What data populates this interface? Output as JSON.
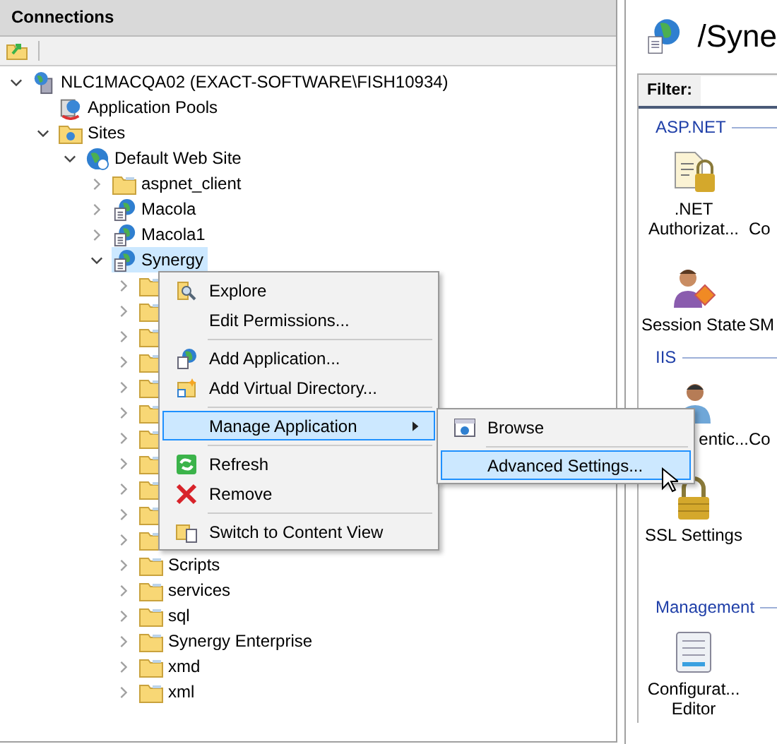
{
  "connections": {
    "title": "Connections"
  },
  "tree": [
    {
      "label": "NLC1MACQA02 (EXACT-SOFTWARE\\FISH10934)",
      "kind": "server",
      "expanded": true,
      "selected": false,
      "children": [
        {
          "label": "Application Pools",
          "kind": "pools",
          "selected": false
        },
        {
          "label": "Sites",
          "kind": "sites",
          "expanded": true,
          "selected": false,
          "children": [
            {
              "label": "Default Web Site",
              "kind": "website",
              "expanded": true,
              "selected": false,
              "children": [
                {
                  "label": "aspnet_client",
                  "kind": "folder",
                  "expanded": false,
                  "selected": false
                },
                {
                  "label": "Macola",
                  "kind": "app",
                  "expanded": false,
                  "selected": false
                },
                {
                  "label": "Macola1",
                  "kind": "app",
                  "expanded": false,
                  "selected": false
                },
                {
                  "label": "Synergy",
                  "kind": "app",
                  "expanded": true,
                  "selected": true,
                  "children": [
                    {
                      "kind": "folder",
                      "expanded": false,
                      "selected": false
                    },
                    {
                      "kind": "folder",
                      "expanded": false,
                      "selected": false
                    },
                    {
                      "kind": "folder",
                      "expanded": false,
                      "selected": false
                    },
                    {
                      "kind": "folder",
                      "expanded": false,
                      "selected": false
                    },
                    {
                      "kind": "folder",
                      "expanded": false,
                      "selected": false
                    },
                    {
                      "kind": "folder",
                      "expanded": false,
                      "selected": false
                    },
                    {
                      "kind": "folder",
                      "expanded": false,
                      "selected": false
                    },
                    {
                      "kind": "folder",
                      "expanded": false,
                      "selected": false
                    },
                    {
                      "kind": "folder",
                      "expanded": false,
                      "selected": false
                    },
                    {
                      "kind": "folder",
                      "expanded": false,
                      "selected": false
                    },
                    {
                      "kind": "folder",
                      "expanded": false,
                      "selected": false
                    },
                    {
                      "label": "Scripts",
                      "kind": "folder",
                      "expanded": false,
                      "selected": false
                    },
                    {
                      "label": "services",
                      "kind": "folder",
                      "expanded": false,
                      "selected": false
                    },
                    {
                      "label": "sql",
                      "kind": "folder",
                      "expanded": false,
                      "selected": false
                    },
                    {
                      "label": "Synergy Enterprise",
                      "kind": "folder",
                      "expanded": false,
                      "selected": false
                    },
                    {
                      "label": "xmd",
                      "kind": "folder",
                      "expanded": false,
                      "selected": false
                    },
                    {
                      "label": "xml",
                      "kind": "folder",
                      "expanded": false,
                      "selected": false
                    }
                  ]
                }
              ]
            }
          ]
        }
      ]
    }
  ],
  "context_menu": {
    "items": [
      {
        "kind": "item",
        "label": "Explore",
        "selected": false
      },
      {
        "kind": "item",
        "label": "Edit Permissions...",
        "selected": false
      },
      {
        "kind": "separator"
      },
      {
        "kind": "item",
        "label": "Add Application...",
        "selected": false
      },
      {
        "kind": "item",
        "label": "Add Virtual Directory...",
        "selected": false
      },
      {
        "kind": "separator"
      },
      {
        "kind": "submenu",
        "label": "Manage Application",
        "selected": true
      },
      {
        "kind": "separator"
      },
      {
        "kind": "item",
        "label": "Refresh",
        "selected": false
      },
      {
        "kind": "item",
        "label": "Remove",
        "selected": false
      },
      {
        "kind": "separator"
      },
      {
        "kind": "item",
        "label": "Switch to Content View",
        "selected": false
      }
    ]
  },
  "submenu": {
    "items": [
      {
        "kind": "item",
        "label": "Browse",
        "selected": false
      },
      {
        "kind": "separator"
      },
      {
        "kind": "item",
        "label": "Advanced Settings...",
        "selected": true
      }
    ]
  },
  "feature_view": {
    "title": "/Syne",
    "filter_label": "Filter:",
    "groups": [
      {
        "title": "ASP.NET",
        "features": [
          {
            "lines": [
              ".NET",
              "Authorizat..."
            ],
            "kind": "authorization"
          },
          {
            "lines": [
              "Co"
            ],
            "kind": "cut"
          },
          {
            "lines": [
              "Session State"
            ],
            "kind": "session"
          },
          {
            "lines": [
              "SM"
            ],
            "kind": "cut"
          }
        ]
      },
      {
        "title": "IIS",
        "features": [
          {
            "lines": [
              "entic..."
            ],
            "kind": "user"
          },
          {
            "lines": [
              "Co"
            ],
            "kind": "cut"
          },
          {
            "lines": [
              "SSL Settings"
            ],
            "kind": "lock"
          }
        ]
      },
      {
        "title": "Management",
        "features": [
          {
            "lines": [
              "Configurat...",
              "Editor"
            ],
            "kind": "config"
          }
        ]
      }
    ]
  }
}
